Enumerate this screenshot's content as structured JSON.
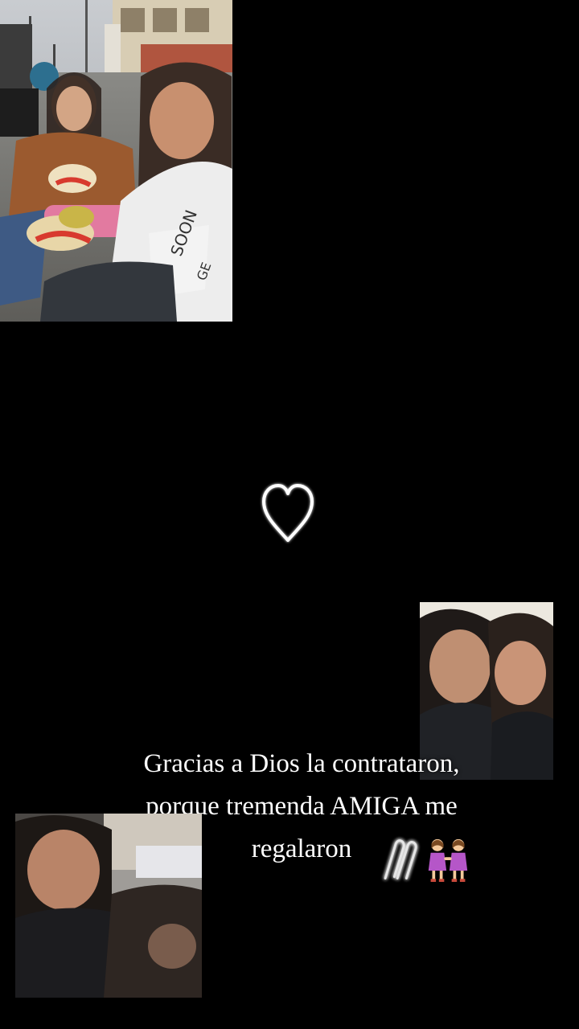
{
  "story": {
    "caption": {
      "line1": "Gracias a Dios la contrataron,",
      "line2": "porque tremenda AMIGA me",
      "line3": "regalaron"
    },
    "icons": {
      "heart": "heart-outline-icon",
      "paperclip": "paperclip-icon",
      "friends": "two-women-icon"
    },
    "colors": {
      "background": "#000000",
      "text": "#ffffff",
      "glow": "#ffffff"
    }
  }
}
